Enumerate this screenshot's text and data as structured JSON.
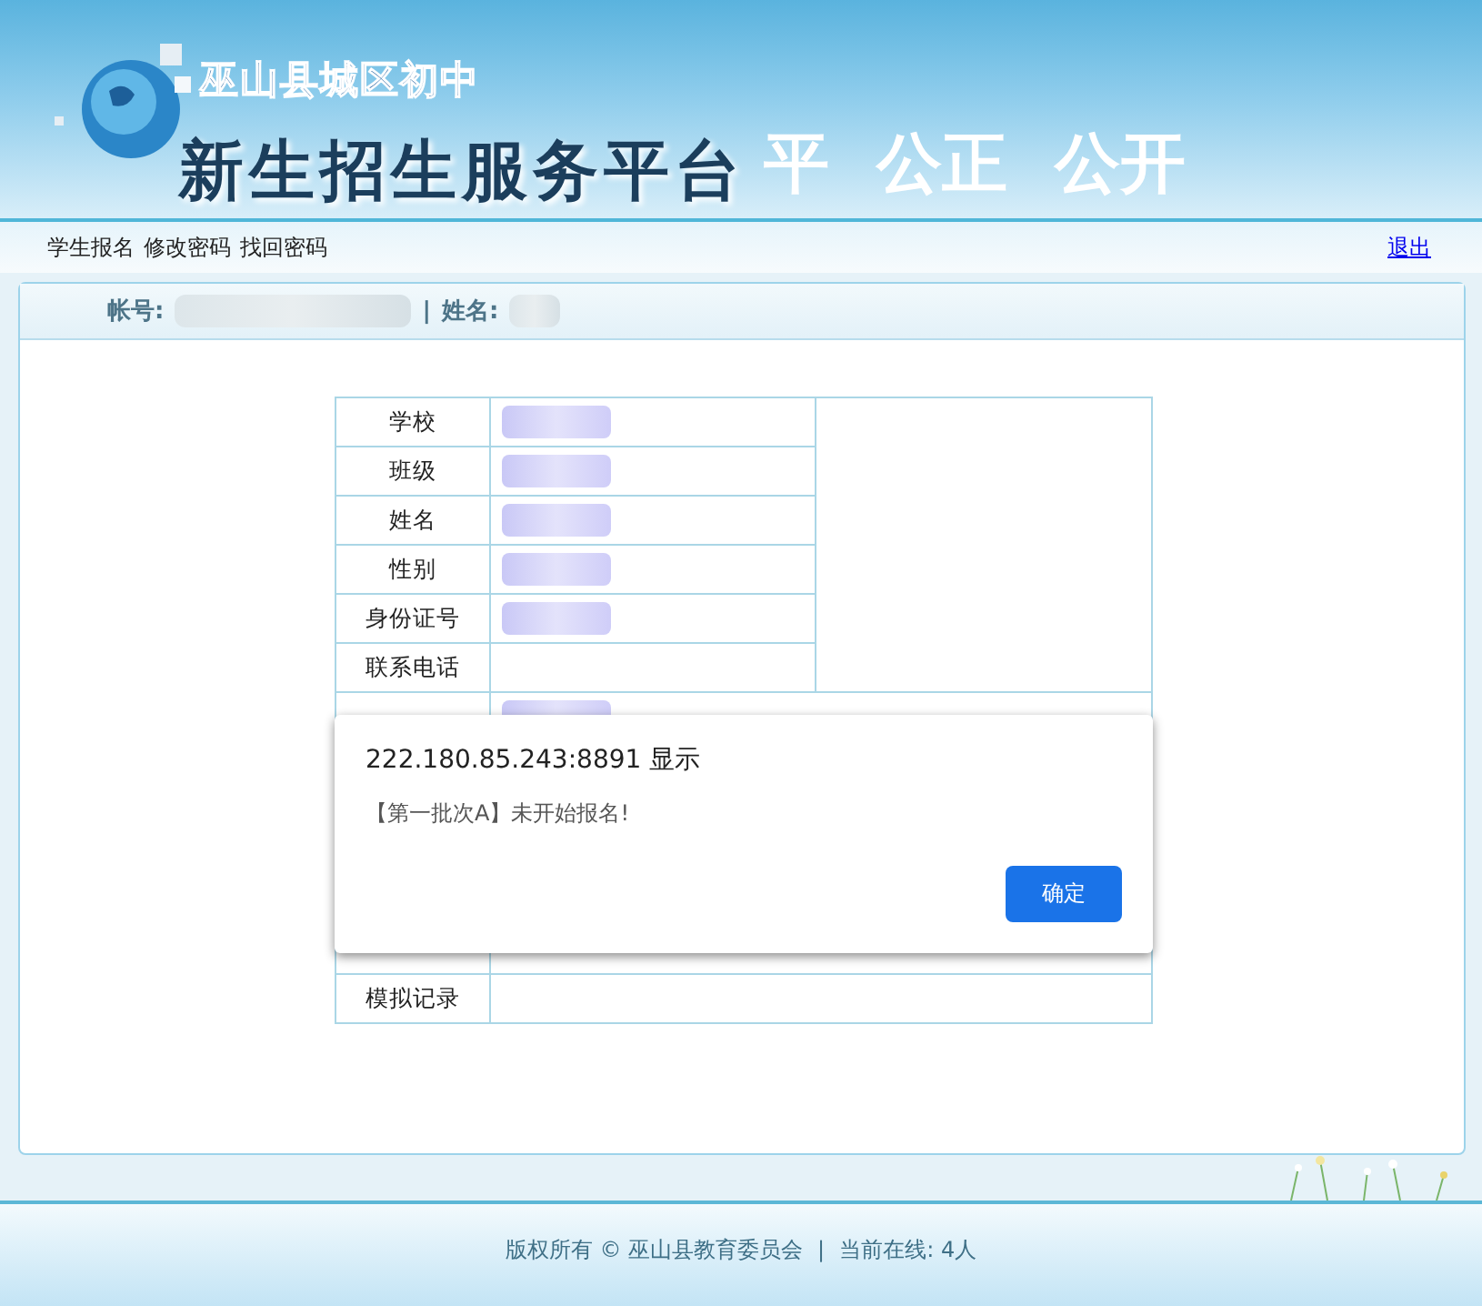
{
  "banner": {
    "subtitle": "巫山县城区初中",
    "title": "新生招生服务平台",
    "slogans": [
      "平",
      "公正",
      "公开"
    ]
  },
  "nav": {
    "links": [
      "学生报名",
      "修改密码",
      "找回密码"
    ],
    "logout": "退出"
  },
  "account_bar": {
    "account_label": "帐号:",
    "account_redacted": true,
    "separator": "|",
    "name_label": "姓名:",
    "name_redacted": true
  },
  "table": {
    "rows": [
      {
        "label": "学校",
        "redacted": true,
        "kind": "photo-side"
      },
      {
        "label": "班级",
        "redacted": true,
        "kind": "photo-side"
      },
      {
        "label": "姓名",
        "redacted": true,
        "kind": "photo-side"
      },
      {
        "label": "性别",
        "redacted": true,
        "kind": "photo-side"
      },
      {
        "label": "身份证号",
        "redacted": true,
        "kind": "photo-side"
      },
      {
        "label": "联系电话",
        "redacted": false,
        "kind": "photo-side"
      },
      {
        "redacted": true,
        "kind": "full"
      },
      {
        "redacted": false,
        "kind": "full"
      },
      {
        "label": "模拟记录",
        "redacted": false,
        "kind": "full"
      }
    ]
  },
  "dialog": {
    "title": "222.180.85.243:8891 显示",
    "message": "【第一批次A】未开始报名!",
    "button": "确定"
  },
  "footer": {
    "copyright": "版权所有 © 巫山县教育委员会",
    "separator": "|",
    "online": "当前在线: 4人"
  }
}
